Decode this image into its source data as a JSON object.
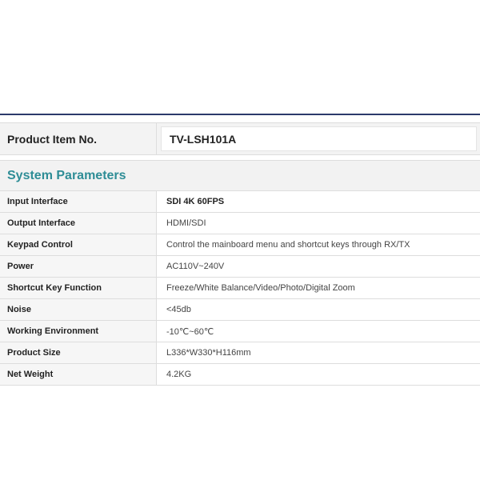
{
  "product": {
    "label": "Product Item No.",
    "value": "TV-LSH101A"
  },
  "section_title": "System Parameters",
  "params": [
    {
      "label": "Input Interface",
      "value": "SDI 4K 60FPS"
    },
    {
      "label": "Output Interface",
      "value": "HDMI/SDI"
    },
    {
      "label": "Keypad Control",
      "value": "Control the mainboard menu and shortcut keys through RX/TX"
    },
    {
      "label": "Power",
      "value": "AC110V~240V"
    },
    {
      "label": "Shortcut Key Function",
      "value": "Freeze/White Balance/Video/Photo/Digital Zoom"
    },
    {
      "label": "Noise",
      "value": "<45db"
    },
    {
      "label": "Working Environment",
      "value": "-10℃~60℃"
    },
    {
      "label": "Product Size",
      "value": "L336*W330*H116mm"
    },
    {
      "label": "Net Weight",
      "value": "4.2KG"
    }
  ]
}
